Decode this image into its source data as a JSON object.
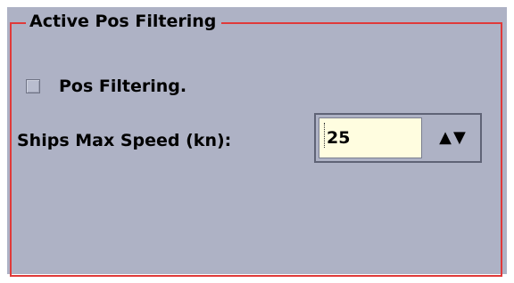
{
  "group": {
    "title": "Active Pos Filtering"
  },
  "pos_filtering": {
    "label": "Pos Filtering.",
    "checked": false
  },
  "max_speed": {
    "label": "Ships Max Speed (kn):",
    "value": "25",
    "up_glyph": "▲",
    "down_glyph": "▼"
  },
  "colors": {
    "panel_background": "#aeb2c5",
    "group_border": "#e03a3a",
    "input_background": "#fffde0"
  },
  "icons": {
    "up": "triangle-up-icon",
    "down": "triangle-down-icon"
  }
}
